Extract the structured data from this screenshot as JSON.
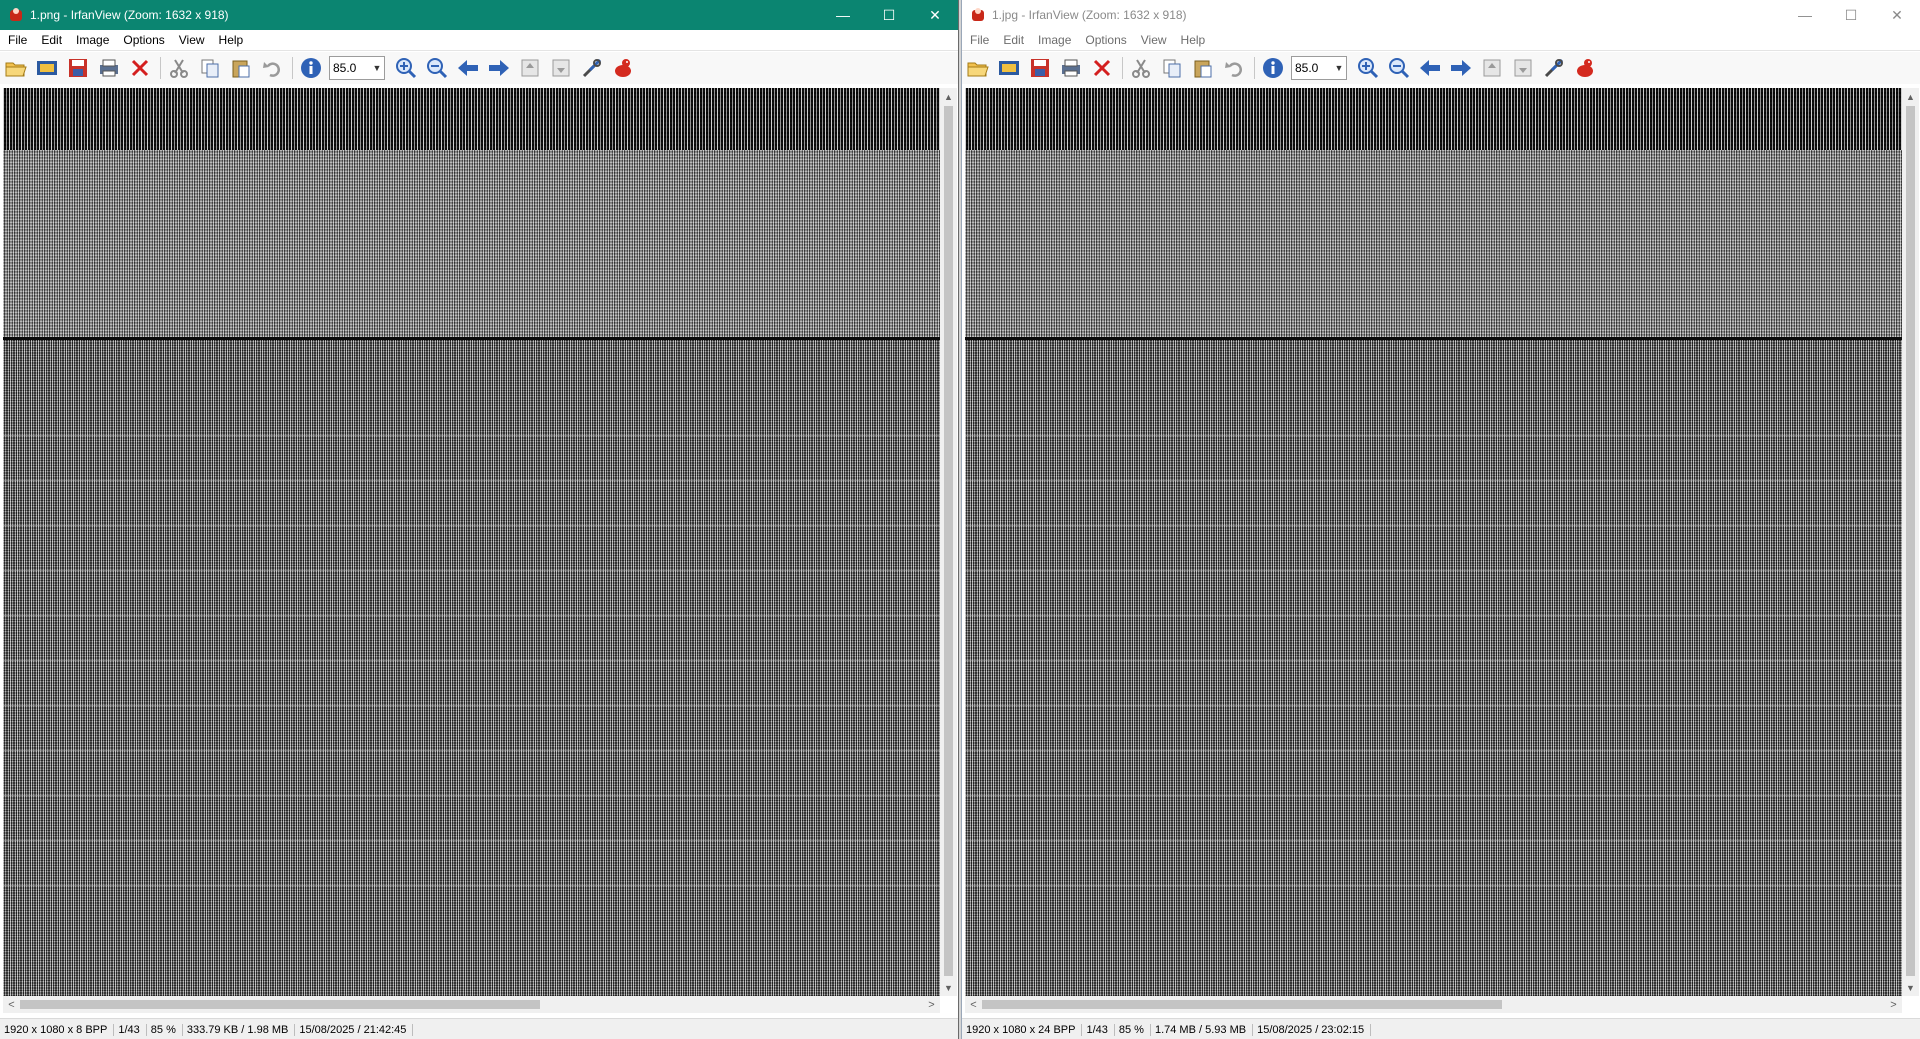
{
  "left_window": {
    "title": "1.png - IrfanView (Zoom: 1632 x 918)",
    "active": true,
    "menu": [
      "File",
      "Edit",
      "Image",
      "Options",
      "View",
      "Help"
    ],
    "zoom_value": "85.0",
    "status": [
      "1920 x 1080 x 8 BPP",
      "1/43",
      "85 %",
      "333.79 KB / 1.98 MB",
      "15/08/2025 / 21:42:45"
    ]
  },
  "right_window": {
    "title": "1.jpg - IrfanView (Zoom: 1632 x 918)",
    "active": false,
    "menu": [
      "File",
      "Edit",
      "Image",
      "Options",
      "View",
      "Help"
    ],
    "zoom_value": "85.0",
    "status": [
      "1920 x 1080 x 24 BPP",
      "1/43",
      "85 %",
      "1.74 MB / 5.93 MB",
      "15/08/2025 / 23:02:15"
    ]
  },
  "window_controls": {
    "minimize": "—",
    "maximize": "☐",
    "close": "✕"
  },
  "toolbar_icons": [
    "open-folder-icon",
    "thumbnails-icon",
    "save-icon",
    "print-icon",
    "delete-icon",
    "cut-icon",
    "copy-icon",
    "paste-icon",
    "undo-icon",
    "info-icon",
    "zoom-in-icon",
    "zoom-out-icon",
    "previous-icon",
    "next-icon",
    "page-up-icon",
    "page-down-icon",
    "settings-icon",
    "irfanview-logo-icon"
  ],
  "colors": {
    "active_title_bg": "#0b8571",
    "inactive_title_fg": "#8a8a8a"
  },
  "scroll": {
    "up": "▲",
    "down": "▼",
    "left": "<",
    "right": ">"
  }
}
